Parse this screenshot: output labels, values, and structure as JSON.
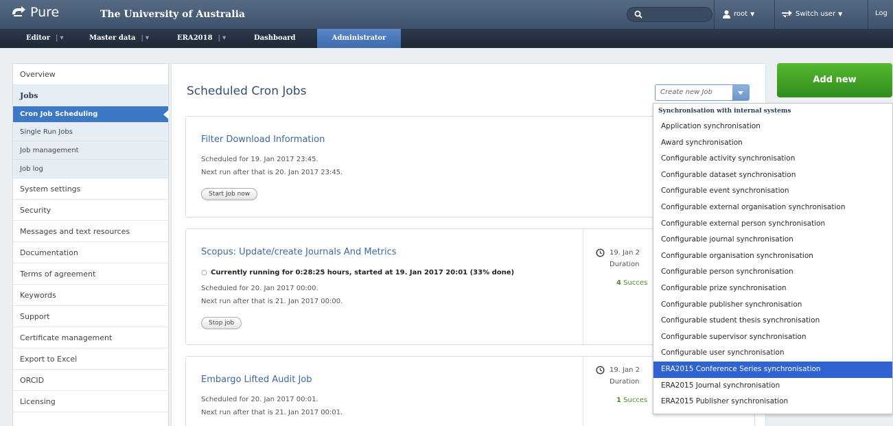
{
  "header": {
    "logo_text": "Pure",
    "org_name": "The University of Australia",
    "user": "root",
    "switch_user": "Switch user",
    "logout": "Log"
  },
  "nav": {
    "items": [
      "Editor",
      "Master data",
      "ERA2018",
      "Dashboard",
      "Administrator"
    ]
  },
  "sidebar": {
    "overview": "Overview",
    "jobs": "Jobs",
    "cron": "Cron Job Scheduling",
    "single": "Single Run Jobs",
    "management": "Job management",
    "log": "Job log",
    "items": [
      "System settings",
      "Security",
      "Messages and text resources",
      "Documentation",
      "Terms of agreement",
      "Keywords",
      "Support",
      "Certificate management",
      "Export to Excel",
      "ORCID",
      "Licensing"
    ]
  },
  "main": {
    "title": "Scheduled Cron Jobs",
    "create_job": "Create new Job"
  },
  "jobs": [
    {
      "title": "Filter Download Information",
      "line1": "Scheduled for 19. Jan 2017 23:45.",
      "line2": "Next run after that is 20. Jan 2017 23:45.",
      "button": "Start Job now"
    },
    {
      "title": "Scopus: Update/create Journals And Metrics",
      "running": "Currently running for 0:28:25 hours, started at 19. Jan 2017 20:01 (33% done)",
      "line1": "Scheduled for 20. Jan 2017 00:00.",
      "line2": "Next run after that is 21. Jan 2017 00:00.",
      "button": "Stop job",
      "side_date": "19. Jan 2",
      "side_duration": "Duration",
      "side_succ_count": "4",
      "side_succ": "Succes"
    },
    {
      "title": "Embargo Lifted Audit Job",
      "line1": "Scheduled for 20. Jan 2017 00:01.",
      "line2": "Next run after that is 21. Jan 2017 00:01.",
      "side_date": "19. Jan 2",
      "side_duration": "Duration",
      "side_succ_count": "1",
      "side_succ": "Succes"
    }
  ],
  "add_new": "Add new",
  "dropdown": {
    "header": "Synchronisation with internal systems",
    "items": [
      "Application synchronisation",
      "Award synchronisation",
      "Configurable activity synchronisation",
      "Configurable dataset synchronisation",
      "Configurable event synchronisation",
      "Configurable external organisation synchronisation",
      "Configurable external person synchronisation",
      "Configurable journal synchronisation",
      "Configurable organisation synchronisation",
      "Configurable person synchronisation",
      "Configurable prize synchronisation",
      "Configurable publisher synchronisation",
      "Configurable student thesis synchronisation",
      "Configurable supervisor synchronisation",
      "Configurable user synchronisation",
      "ERA2015 Conference Series synchronisation",
      "ERA2015 Journal synchronisation",
      "ERA2015 Publisher synchronisation"
    ],
    "selected_index": 15
  },
  "colors": {
    "topbar": "#4a5d77",
    "accent": "#3c78c4",
    "add_new": "#3fa226",
    "selected": "#2f63d2"
  }
}
